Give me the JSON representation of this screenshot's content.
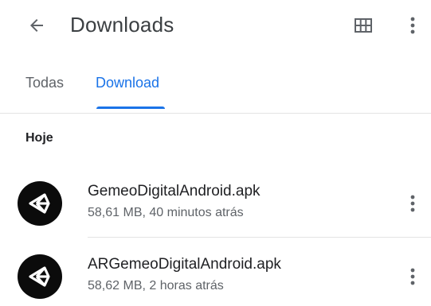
{
  "appbar": {
    "title": "Downloads",
    "back_icon": "arrow-back-icon",
    "grid_icon": "grid-view-icon",
    "more_icon": "more-vert-icon"
  },
  "tabs": [
    {
      "label": "Todas",
      "selected": false
    },
    {
      "label": "Download",
      "selected": true
    }
  ],
  "accent_color": "#1a73e8",
  "section": {
    "title": "Hoje"
  },
  "files": [
    {
      "name": "GemeoDigitalAndroid.apk",
      "meta": "58,61 MB, 40 minutos atrás",
      "icon": "unity-logo-icon"
    },
    {
      "name": "ARGemeoDigitalAndroid.apk",
      "meta": "58,62 MB, 2 horas atrás",
      "icon": "unity-logo-icon"
    }
  ]
}
